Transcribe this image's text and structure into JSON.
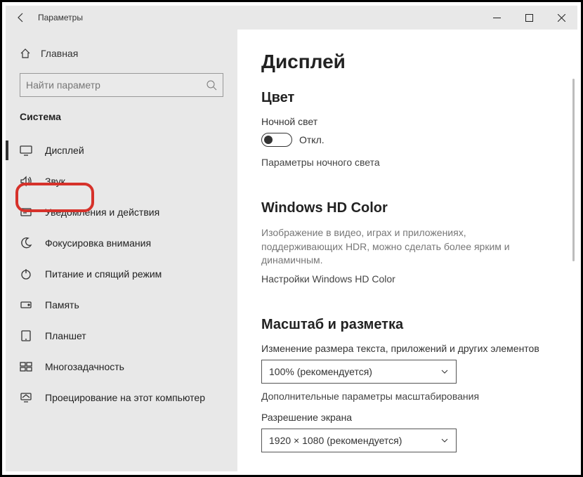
{
  "titlebar": {
    "title": "Параметры"
  },
  "sidebar": {
    "home": "Главная",
    "search_placeholder": "Найти параметр",
    "category": "Система",
    "items": [
      {
        "label": "Дисплей"
      },
      {
        "label": "Звук"
      },
      {
        "label": "Уведомления и действия"
      },
      {
        "label": "Фокусировка внимания"
      },
      {
        "label": "Питание и спящий режим"
      },
      {
        "label": "Память"
      },
      {
        "label": "Планшет"
      },
      {
        "label": "Многозадачность"
      },
      {
        "label": "Проецирование на этот компьютер"
      }
    ]
  },
  "main": {
    "title": "Дисплей",
    "color": {
      "heading": "Цвет",
      "night_light_label": "Ночной свет",
      "night_light_state": "Откл.",
      "night_light_link": "Параметры ночного света"
    },
    "hd": {
      "heading": "Windows HD Color",
      "desc": "Изображение в видео, играх и приложениях, поддерживающих HDR, можно сделать более ярким и динамичным.",
      "link": "Настройки Windows HD Color"
    },
    "scale": {
      "heading": "Масштаб и разметка",
      "scale_label": "Изменение размера текста, приложений и других элементов",
      "scale_value": "100% (рекомендуется)",
      "scale_link": "Дополнительные параметры масштабирования",
      "res_label": "Разрешение экрана",
      "res_value": "1920 × 1080 (рекомендуется)"
    }
  }
}
